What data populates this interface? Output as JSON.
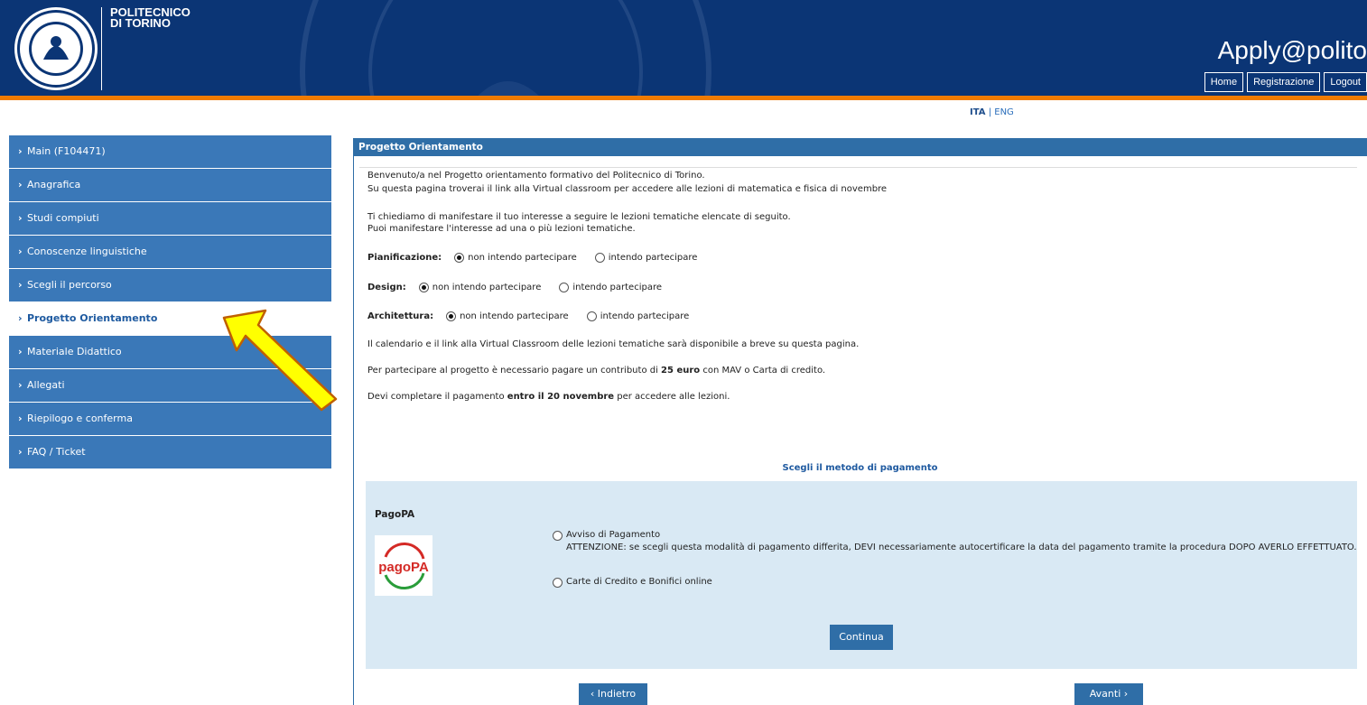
{
  "header": {
    "logo_line1": "POLITECNICO",
    "logo_line2": "DI TORINO",
    "app_title": "Apply@polito",
    "nav": [
      "Home",
      "Registrazione",
      "Logout"
    ]
  },
  "lang": {
    "ita": "ITA",
    "sep": " | ",
    "eng": "ENG"
  },
  "sidebar": {
    "items": [
      {
        "label": "Main (F104471)"
      },
      {
        "label": "Anagrafica"
      },
      {
        "label": "Studi compiuti"
      },
      {
        "label": "Conoscenze linguistiche"
      },
      {
        "label": "Scegli il percorso"
      },
      {
        "label": "Progetto Orientamento"
      },
      {
        "label": "Materiale Didattico"
      },
      {
        "label": "Allegati"
      },
      {
        "label": "Riepilogo e conferma"
      },
      {
        "label": "FAQ / Ticket"
      }
    ]
  },
  "main": {
    "title": "Progetto Orientamento",
    "intro1": "Benvenuto/a nel Progetto orientamento formativo del Politecnico di Torino.",
    "intro2": "Su questa pagina troverai il link alla Virtual classroom per accedere alle lezioni di matematica e fisica di novembre",
    "interest1": "Ti chiediamo di manifestare il tuo interesse a seguire le lezioni tematiche elencate di seguito.",
    "interest2": "Puoi manifestare l'interesse ad una o più lezioni tematiche.",
    "choices": [
      {
        "label": "Pianificazione:",
        "opt_no": "non intendo partecipare",
        "opt_yes": "intendo partecipare"
      },
      {
        "label": "Design:",
        "opt_no": "non intendo partecipare",
        "opt_yes": "intendo partecipare"
      },
      {
        "label": "Architettura:",
        "opt_no": "non intendo partecipare",
        "opt_yes": "intendo partecipare"
      }
    ],
    "calendar": "Il calendario e il link alla Virtual Classroom delle lezioni tematiche sarà disponibile a breve su questa pagina.",
    "fee_pre": "Per partecipare al progetto è necessario pagare un contributo di ",
    "fee_amount": "25 euro",
    "fee_post": " con MAV o Carta di credito.",
    "deadline_pre": "Devi completare il pagamento ",
    "deadline_bold": "entro il 20 novembre",
    "deadline_post": " per accedere alle lezioni."
  },
  "payment": {
    "title": "Scegli il metodo di pagamento",
    "provider": "PagoPA",
    "logo_text": "pagoPA",
    "option1": "Avviso di Pagamento",
    "option1_note": "ATTENZIONE: se scegli questa modalità di pagamento differita, DEVI necessariamente autocertificare la data del pagamento tramite la procedura DOPO AVERLO EFFETTUATO.",
    "option2": "Carte di Credito e Bonifici online",
    "continue": "Continua"
  },
  "footer_nav": {
    "back": "Indietro",
    "next": "Avanti"
  },
  "colors": {
    "header": "#0b3575",
    "accent_orange": "#f07b00",
    "sidebar": "#3a78b8",
    "highlight_arrow": "#ffff00"
  }
}
